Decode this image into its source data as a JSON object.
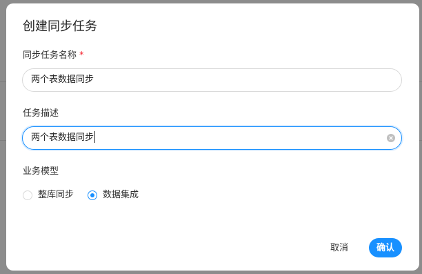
{
  "dialog": {
    "title": "创建同步任务"
  },
  "form": {
    "task_name": {
      "label": "同步任务名称",
      "required_mark": "*",
      "value": "两个表数据同步"
    },
    "task_description": {
      "label": "任务描述",
      "value": "两个表数据同步"
    },
    "business_model": {
      "label": "业务模型",
      "options": [
        {
          "label": "整库同步",
          "selected": false
        },
        {
          "label": "数据集成",
          "selected": true
        }
      ]
    }
  },
  "footer": {
    "cancel_label": "取消",
    "confirm_label": "确认"
  },
  "colors": {
    "accent": "#1890ff",
    "required": "#f5222d",
    "backdrop": "#8c8c8c"
  },
  "icons": {
    "clear": "close-circle-icon"
  }
}
